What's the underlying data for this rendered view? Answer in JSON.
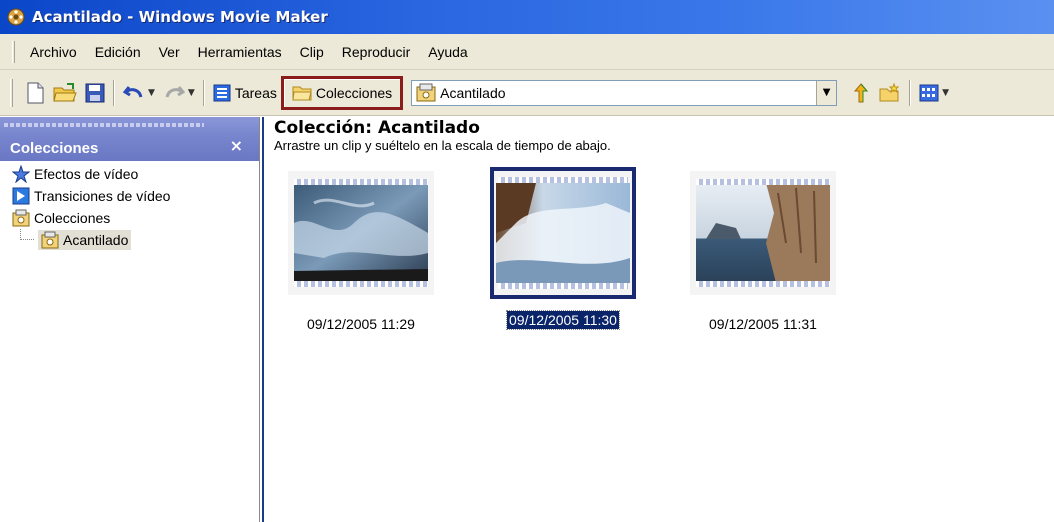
{
  "window": {
    "title": "Acantilado - Windows Movie Maker",
    "app_icon": "movie-maker-icon"
  },
  "menu": [
    "Archivo",
    "Edición",
    "Ver",
    "Herramientas",
    "Clip",
    "Reproducir",
    "Ayuda"
  ],
  "toolbar": {
    "tasks_label": "Tareas",
    "collections_label": "Colecciones",
    "collection_select_value": "Acantilado",
    "highlight_color": "#8a1c1c"
  },
  "left_pane": {
    "title": "Colecciones",
    "close_glyph": "×",
    "tree": [
      {
        "label": "Efectos de vídeo",
        "icon": "star-effects-icon"
      },
      {
        "label": "Transiciones de vídeo",
        "icon": "transition-icon"
      },
      {
        "label": "Colecciones",
        "icon": "collection-folder-icon"
      },
      {
        "label": "Acantilado",
        "icon": "collection-folder-icon"
      }
    ]
  },
  "main": {
    "title": "Colección: Acantilado",
    "subtitle": "Arrastre un clip y suéltelo en la escala de tiempo de abajo.",
    "clips": [
      {
        "label": "09/12/2005 11:29",
        "selected": false
      },
      {
        "label": "09/12/2005 11:30",
        "selected": true
      },
      {
        "label": "09/12/2005 11:31",
        "selected": false
      }
    ]
  }
}
